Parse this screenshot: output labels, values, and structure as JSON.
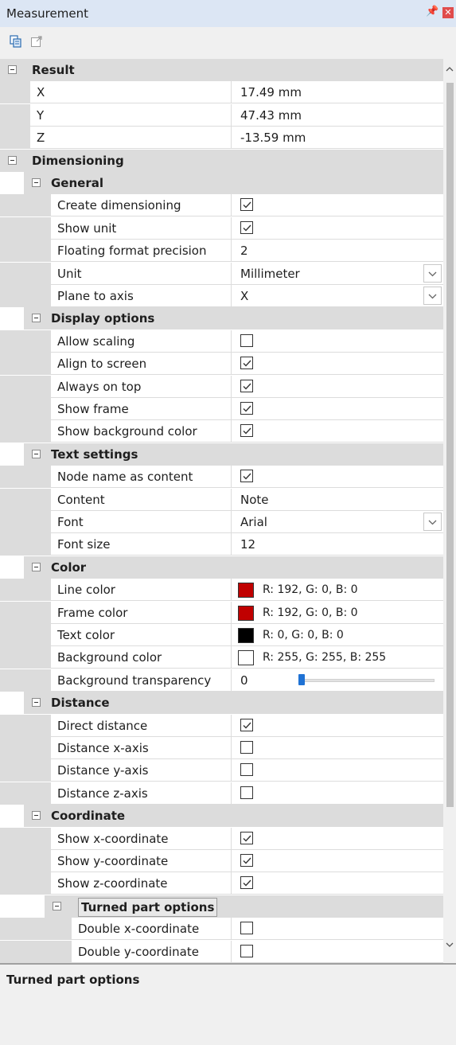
{
  "window": {
    "title": "Measurement"
  },
  "description": {
    "title": "Turned part options"
  },
  "rows": [
    {
      "kind": "cat",
      "level": 0,
      "label": "Result"
    },
    {
      "kind": "prop",
      "level": 1,
      "label": "X",
      "value": "17.49 mm"
    },
    {
      "kind": "prop",
      "level": 1,
      "label": "Y",
      "value": "47.43 mm"
    },
    {
      "kind": "prop",
      "level": 1,
      "label": "Z",
      "value": "-13.59 mm"
    },
    {
      "kind": "cat",
      "level": 0,
      "label": "Dimensioning"
    },
    {
      "kind": "cat",
      "level": 1,
      "label": "General"
    },
    {
      "kind": "check",
      "level": 2,
      "label": "Create dimensioning",
      "checked": true
    },
    {
      "kind": "check",
      "level": 2,
      "label": "Show unit",
      "checked": true
    },
    {
      "kind": "prop",
      "level": 2,
      "label": "Floating format precision",
      "value": "2"
    },
    {
      "kind": "dropdown",
      "level": 2,
      "label": "Unit",
      "value": "Millimeter"
    },
    {
      "kind": "dropdown",
      "level": 2,
      "label": "Plane to axis",
      "value": "X"
    },
    {
      "kind": "cat",
      "level": 1,
      "label": "Display options"
    },
    {
      "kind": "check",
      "level": 2,
      "label": "Allow scaling",
      "checked": false
    },
    {
      "kind": "check",
      "level": 2,
      "label": "Align to screen",
      "checked": true
    },
    {
      "kind": "check",
      "level": 2,
      "label": "Always on top",
      "checked": true
    },
    {
      "kind": "check",
      "level": 2,
      "label": "Show frame",
      "checked": true
    },
    {
      "kind": "check",
      "level": 2,
      "label": "Show background color",
      "checked": true
    },
    {
      "kind": "cat",
      "level": 1,
      "label": "Text settings"
    },
    {
      "kind": "check",
      "level": 2,
      "label": "Node name as content",
      "checked": true
    },
    {
      "kind": "prop",
      "level": 2,
      "label": "Content",
      "value": "Note"
    },
    {
      "kind": "dropdown",
      "level": 2,
      "label": "Font",
      "value": "Arial"
    },
    {
      "kind": "prop",
      "level": 2,
      "label": "Font size",
      "value": "12"
    },
    {
      "kind": "cat",
      "level": 1,
      "label": "Color"
    },
    {
      "kind": "color",
      "level": 2,
      "label": "Line color",
      "value": "R: 192, G: 0, B: 0",
      "swatch": "#c00000"
    },
    {
      "kind": "color",
      "level": 2,
      "label": "Frame color",
      "value": "R: 192, G: 0, B: 0",
      "swatch": "#c00000"
    },
    {
      "kind": "color",
      "level": 2,
      "label": "Text color",
      "value": "R: 0, G: 0, B: 0",
      "swatch": "#000000"
    },
    {
      "kind": "color",
      "level": 2,
      "label": "Background color",
      "value": "R: 255, G: 255, B: 255",
      "swatch": "#ffffff"
    },
    {
      "kind": "slider",
      "level": 2,
      "label": "Background transparency",
      "value": "0",
      "fraction": 0
    },
    {
      "kind": "cat",
      "level": 1,
      "label": "Distance"
    },
    {
      "kind": "check",
      "level": 2,
      "label": "Direct distance",
      "checked": true
    },
    {
      "kind": "check",
      "level": 2,
      "label": "Distance x-axis",
      "checked": false
    },
    {
      "kind": "check",
      "level": 2,
      "label": "Distance y-axis",
      "checked": false
    },
    {
      "kind": "check",
      "level": 2,
      "label": "Distance z-axis",
      "checked": false
    },
    {
      "kind": "cat",
      "level": 1,
      "label": "Coordinate"
    },
    {
      "kind": "check",
      "level": 2,
      "label": "Show x-coordinate",
      "checked": true
    },
    {
      "kind": "check",
      "level": 2,
      "label": "Show y-coordinate",
      "checked": true
    },
    {
      "kind": "check",
      "level": 2,
      "label": "Show z-coordinate",
      "checked": true
    },
    {
      "kind": "cat",
      "level": 2,
      "label": "Turned part options",
      "selected": true
    },
    {
      "kind": "check",
      "level": 3,
      "label": "Double x-coordinate",
      "checked": false
    },
    {
      "kind": "check",
      "level": 3,
      "label": "Double y-coordinate",
      "checked": false
    }
  ]
}
